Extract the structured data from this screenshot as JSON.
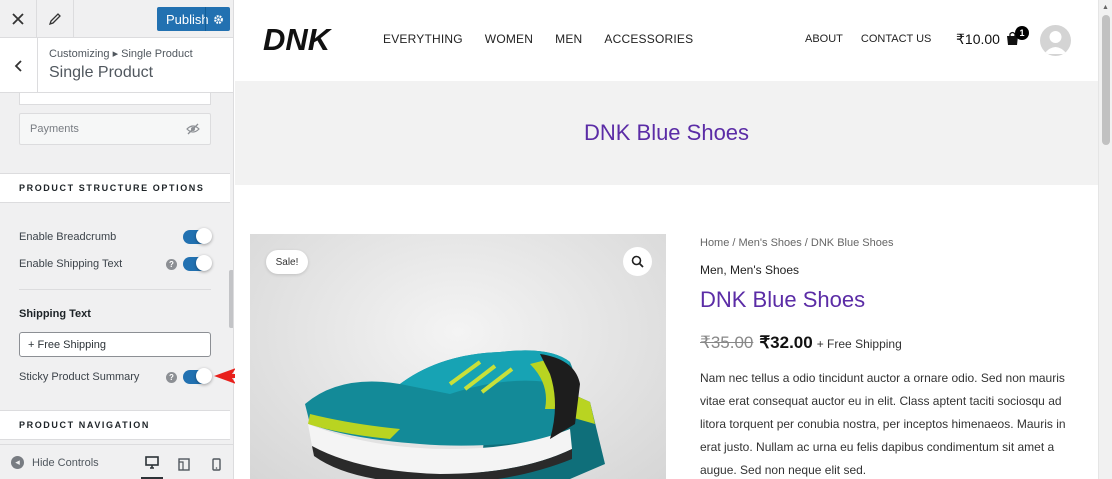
{
  "customizer": {
    "publish_label": "Publish",
    "breadcrumb": "Customizing ▸ Single Product",
    "section_title": "Single Product",
    "payments_label": "Payments",
    "structure_heading": "PRODUCT STRUCTURE OPTIONS",
    "options": [
      {
        "label": "Enable Breadcrumb",
        "enabled": true
      },
      {
        "label": "Enable Shipping Text",
        "enabled": true
      },
      {
        "label": "Sticky Product Summary",
        "enabled": true
      }
    ],
    "shipping_text_label": "Shipping Text",
    "shipping_text_value": "+ Free Shipping",
    "navigation_heading": "PRODUCT NAVIGATION",
    "hide_controls": "Hide Controls",
    "accent_color": "#2271b1"
  },
  "preview": {
    "logo": "DNK",
    "nav": [
      "EVERYTHING",
      "WOMEN",
      "MEN",
      "ACCESSORIES"
    ],
    "nav_right": [
      "ABOUT",
      "CONTACT US"
    ],
    "cart_total": "₹10.00",
    "cart_count": "1",
    "page_title": "DNK Blue Shoes",
    "sale_badge": "Sale!",
    "breadcrumb": "Home / Men's Shoes / DNK Blue Shoes",
    "categories": "Men, Men's Shoes",
    "product_title": "DNK Blue Shoes",
    "old_price": "₹35.00",
    "new_price": "₹32.00",
    "shipping_note": "+ Free Shipping",
    "description": "Nam nec tellus a odio tincidunt auctor a ornare odio. Sed non mauris vitae erat consequat auctor eu in elit. Class aptent taciti sociosqu ad litora torquent per conubia nostra, per inceptos himenaeos. Mauris in erat justo. Nullam ac urna eu felis dapibus condimentum sit amet a augue. Sed non neque elit sed.",
    "title_color": "#5b2ca6"
  }
}
